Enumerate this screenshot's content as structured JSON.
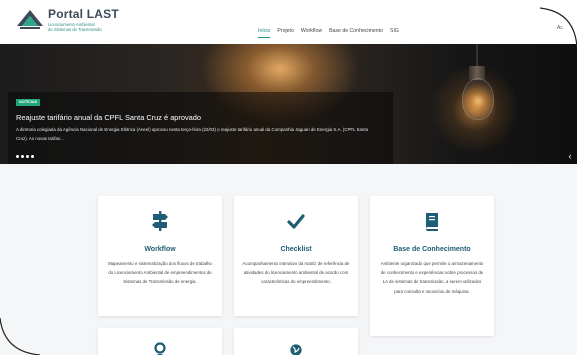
{
  "header": {
    "logo_title": "Portal LAST",
    "logo_sub_line1": "Licenciamento Ambiental",
    "logo_sub_line2": "de Sistemas de Transmissão",
    "right_text": "Ac",
    "nav": [
      {
        "label": "Início",
        "active": true
      },
      {
        "label": "Projeto",
        "active": false
      },
      {
        "label": "Workflow",
        "active": false
      },
      {
        "label": "Base de Conhecimento",
        "active": false
      },
      {
        "label": "SIG",
        "active": false
      }
    ]
  },
  "hero": {
    "tag": "NOTÍCIAS",
    "title": "Reajuste tarifário anual da CPFL Santa Cruz é aprovado",
    "text": "A diretoria colegiada da Agência Nacional de Energia Elétrica (Aneel) aprovou nesta terça-feira (22/03) o reajuste tarifário anual da Companhia Jaguari de Energia S.A. (CPFL Santa Cruz). As novas tarifas...",
    "slides": 4,
    "next_icon": "‹"
  },
  "cards": [
    {
      "icon": "signpost-icon",
      "title": "Workflow",
      "desc": "Mapeamento e sistematização dos fluxos de trabalho do Licenciamento Ambiental de empreendimentos de Sistemas de Transmissão de energia."
    },
    {
      "icon": "checkmark-icon",
      "title": "Checklist",
      "desc": "Acompanhamento interativo da matriz de referência de atividades do licenciamento ambiental de acordo com características do empreendimento."
    },
    {
      "icon": "book-icon",
      "title": "Base de Conhecimento",
      "desc": "Ambiente organizado que permite o armazenamento de conhecimento e experiências sobre processos de LA de sistemas de transmissão, a serem utilizados para consulta e raciocínio de máquina."
    }
  ],
  "cards_row2": [
    {
      "icon": "map-pin-icon"
    },
    {
      "icon": "globe-icon"
    }
  ],
  "colors": {
    "accent": "#1c8f7a",
    "card_title": "#1e5d73",
    "tag": "#21a67a"
  }
}
